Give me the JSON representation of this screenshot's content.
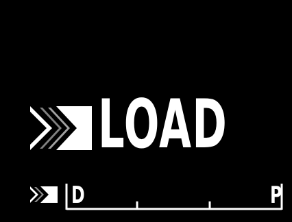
{
  "main": {
    "label": "LOAD",
    "icon": "forward-load-icon"
  },
  "scale": {
    "icon": "forward-load-mini-icon",
    "start_label": "D",
    "end_label": "P"
  },
  "colors": {
    "background": "#000000",
    "foreground": "#ffffff",
    "dim": "#808080"
  }
}
